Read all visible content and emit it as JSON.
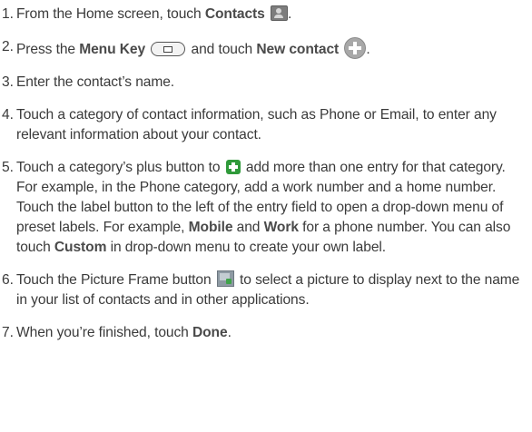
{
  "steps": [
    {
      "num": "1.",
      "t1": "From the Home screen, touch ",
      "b1": "Contacts",
      "t2": "."
    },
    {
      "num": "2.",
      "t1": "Press the ",
      "b1": "Menu Key",
      "t2": " and touch ",
      "b2": "New contact",
      "t3": "."
    },
    {
      "num": "3.",
      "t1": "Enter the contact’s name."
    },
    {
      "num": "4.",
      "t1": "Touch a category of contact information, such as Phone or Email, to enter any relevant information about your contact."
    },
    {
      "num": "5.",
      "t1": "Touch a category’s plus button to ",
      "t2": " add more than one entry for that category. For example, in the Phone category, add a work number and a home number. Touch the label button to the left of the entry field to open a drop-down menu of preset labels. For example, ",
      "b1": "Mobile",
      "t3": " and ",
      "b2": "Work",
      "t4": " for a phone number. You can also touch ",
      "b3": "Custom",
      "t5": " in drop-down menu to create your own label."
    },
    {
      "num": "6.",
      "t1": "Touch the Picture Frame button ",
      "t2": " to select a picture to display next to the name in your list of contacts and in other applications."
    },
    {
      "num": "7.",
      "t1": "When you’re finished, touch ",
      "b1": "Done",
      "t2": "."
    }
  ],
  "icons": {
    "contacts": "contacts-app-icon",
    "menu_key": "menu-key-icon",
    "new_contact": "plus-circle-icon",
    "add_entry": "green-plus-icon",
    "picture_frame": "picture-frame-icon"
  },
  "colors": {
    "text": "#3a3a3a",
    "add_entry_icon": "#2f9a3a"
  }
}
